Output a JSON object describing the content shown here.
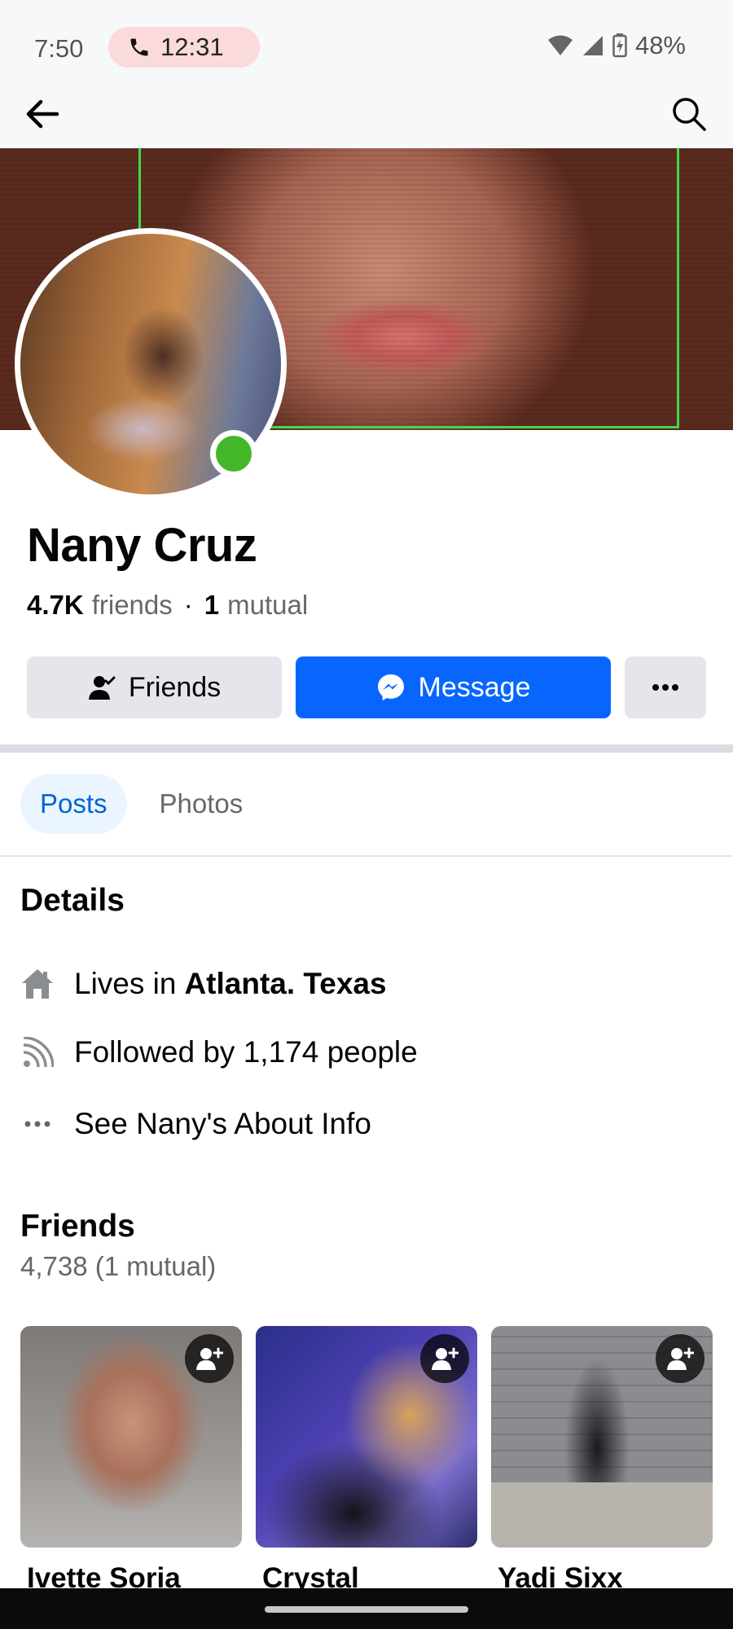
{
  "status_bar": {
    "time": "7:50",
    "call_time": "12:31",
    "battery": "48%",
    "icons": [
      "phone-icon",
      "wifi-icon",
      "signal-icon",
      "battery-icon"
    ],
    "call_pill_color": "#fadadb"
  },
  "nav": {
    "back_icon": "arrow-left-icon",
    "search_icon": "search-icon"
  },
  "profile": {
    "name": "Nany Cruz",
    "friends_count": "4.7K",
    "friends_word": "friends",
    "separator": "·",
    "mutual_count": "1",
    "mutual_word": "mutual",
    "online": true,
    "online_color": "#42b72a"
  },
  "actions": {
    "friends_label": "Friends",
    "message_label": "Message",
    "more_icon": "more-horizontal-icon",
    "message_color": "#0866ff"
  },
  "tabs": [
    {
      "label": "Posts",
      "active": true
    },
    {
      "label": "Photos",
      "active": false
    }
  ],
  "details": {
    "title": "Details",
    "lives_in_prefix": "Lives in",
    "lives_in_place": "Atlanta. Texas",
    "followed_by": "Followed by 1,174 people",
    "see_about": "See Nany's About Info"
  },
  "friends_section": {
    "title": "Friends",
    "count": "4,738 (1 mutual)",
    "items": [
      {
        "name": "Ivette Soria"
      },
      {
        "name": "Crystal"
      },
      {
        "name": "Yadi Sixx"
      }
    ]
  }
}
